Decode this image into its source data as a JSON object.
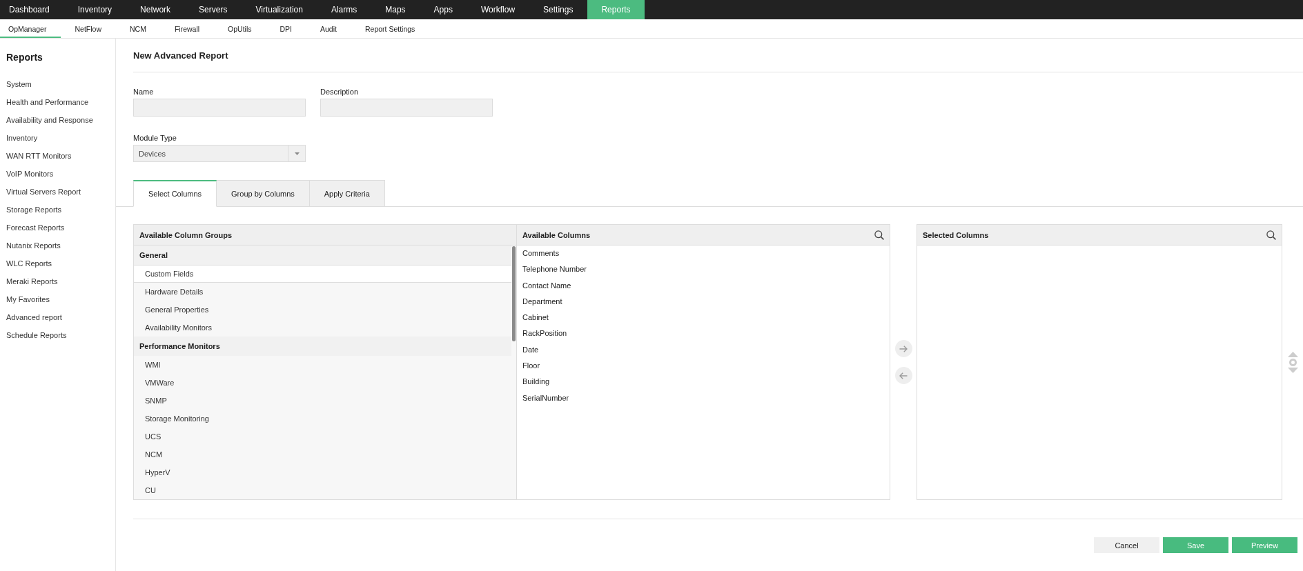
{
  "top_nav": {
    "items": [
      {
        "label": "Dashboard",
        "selected": false
      },
      {
        "label": "Inventory",
        "selected": false
      },
      {
        "label": "Network",
        "selected": false
      },
      {
        "label": "Servers",
        "selected": false
      },
      {
        "label": "Virtualization",
        "selected": false
      },
      {
        "label": "Alarms",
        "selected": false
      },
      {
        "label": "Maps",
        "selected": false
      },
      {
        "label": "Apps",
        "selected": false
      },
      {
        "label": "Workflow",
        "selected": false
      },
      {
        "label": "Settings",
        "selected": false
      },
      {
        "label": "Reports",
        "selected": true
      }
    ]
  },
  "sub_nav": {
    "items": [
      {
        "label": "OpManager",
        "selected": true
      },
      {
        "label": "NetFlow",
        "selected": false
      },
      {
        "label": "NCM",
        "selected": false
      },
      {
        "label": "Firewall",
        "selected": false
      },
      {
        "label": "OpUtils",
        "selected": false
      },
      {
        "label": "DPI",
        "selected": false
      },
      {
        "label": "Audit",
        "selected": false
      },
      {
        "label": "Report Settings",
        "selected": false
      }
    ]
  },
  "sidebar": {
    "title": "Reports",
    "items": [
      "System",
      "Health and Performance",
      "Availability and Response",
      "Inventory",
      "WAN RTT Monitors",
      "VoIP Monitors",
      "Virtual Servers Report",
      "Storage Reports",
      "Forecast Reports",
      "Nutanix Reports",
      "WLC Reports",
      "Meraki Reports",
      "My Favorites",
      "Advanced report",
      "Schedule Reports"
    ]
  },
  "page": {
    "title": "New Advanced Report"
  },
  "form": {
    "name": {
      "label": "Name"
    },
    "description": {
      "label": "Description"
    },
    "module_type": {
      "label": "Module Type",
      "value": "Devices"
    }
  },
  "tabs": [
    {
      "label": "Select Columns",
      "selected": true
    },
    {
      "label": "Group by Columns",
      "selected": false
    },
    {
      "label": "Apply Criteria",
      "selected": false
    }
  ],
  "column_groups": {
    "title": "Available Column Groups",
    "groups": [
      {
        "label": "General",
        "children": [
          {
            "label": "Custom Fields",
            "selected": true
          },
          {
            "label": "Hardware Details",
            "selected": false
          },
          {
            "label": "General Properties",
            "selected": false
          },
          {
            "label": "Availability Monitors",
            "selected": false
          }
        ]
      },
      {
        "label": "Performance Monitors",
        "children": [
          {
            "label": "WMI",
            "selected": false
          },
          {
            "label": "VMWare",
            "selected": false
          },
          {
            "label": "SNMP",
            "selected": false
          },
          {
            "label": "Storage Monitoring",
            "selected": false
          },
          {
            "label": "UCS",
            "selected": false
          },
          {
            "label": "NCM",
            "selected": false
          },
          {
            "label": "HyperV",
            "selected": false
          },
          {
            "label": "CU",
            "selected": false
          }
        ]
      }
    ]
  },
  "available_columns": {
    "title": "Available Columns",
    "items": [
      "Comments",
      "Telephone Number",
      "Contact Name",
      "Department",
      "Cabinet",
      "RackPosition",
      "Date",
      "Floor",
      "Building",
      "SerialNumber"
    ]
  },
  "selected_columns": {
    "title": "Selected Columns"
  },
  "buttons": [
    {
      "label": "Cancel",
      "kind": "secondary"
    },
    {
      "label": "Save",
      "kind": "primary"
    },
    {
      "label": "Preview",
      "kind": "primary"
    }
  ]
}
